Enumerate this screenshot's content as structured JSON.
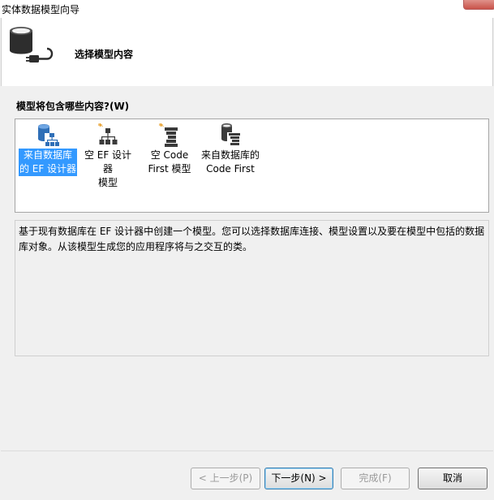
{
  "window": {
    "title": "实体数据模型向导"
  },
  "header": {
    "title": "选择模型内容"
  },
  "models": {
    "label": "模型将包含哪些内容?(W)",
    "items": [
      {
        "label": "来自数据库\n的 EF 设计器",
        "icon": "database-diagram-icon",
        "selected": true
      },
      {
        "label": "空 EF 设计器\n模型",
        "icon": "empty-diagram-icon",
        "selected": false
      },
      {
        "label": "空 Code\nFirst 模型",
        "icon": "empty-code-first-icon",
        "selected": false
      },
      {
        "label": "来自数据库的\nCode First",
        "icon": "database-code-first-icon",
        "selected": false
      }
    ]
  },
  "description": "基于现有数据库在 EF 设计器中创建一个模型。您可以选择数据库连接、模型设置以及要在模型中包括的数据库对象。从该模型生成您的应用程序将与之交互的类。",
  "buttons": {
    "back": "< 上一步(P)",
    "next": "下一步(N) >",
    "finish": "完成(F)",
    "cancel": "取消"
  },
  "colors": {
    "selection": "#3399ff",
    "icon_blue": "#2f6fb7",
    "icon_dark": "#3b3b3b",
    "accent_orange": "#e69a1e"
  }
}
